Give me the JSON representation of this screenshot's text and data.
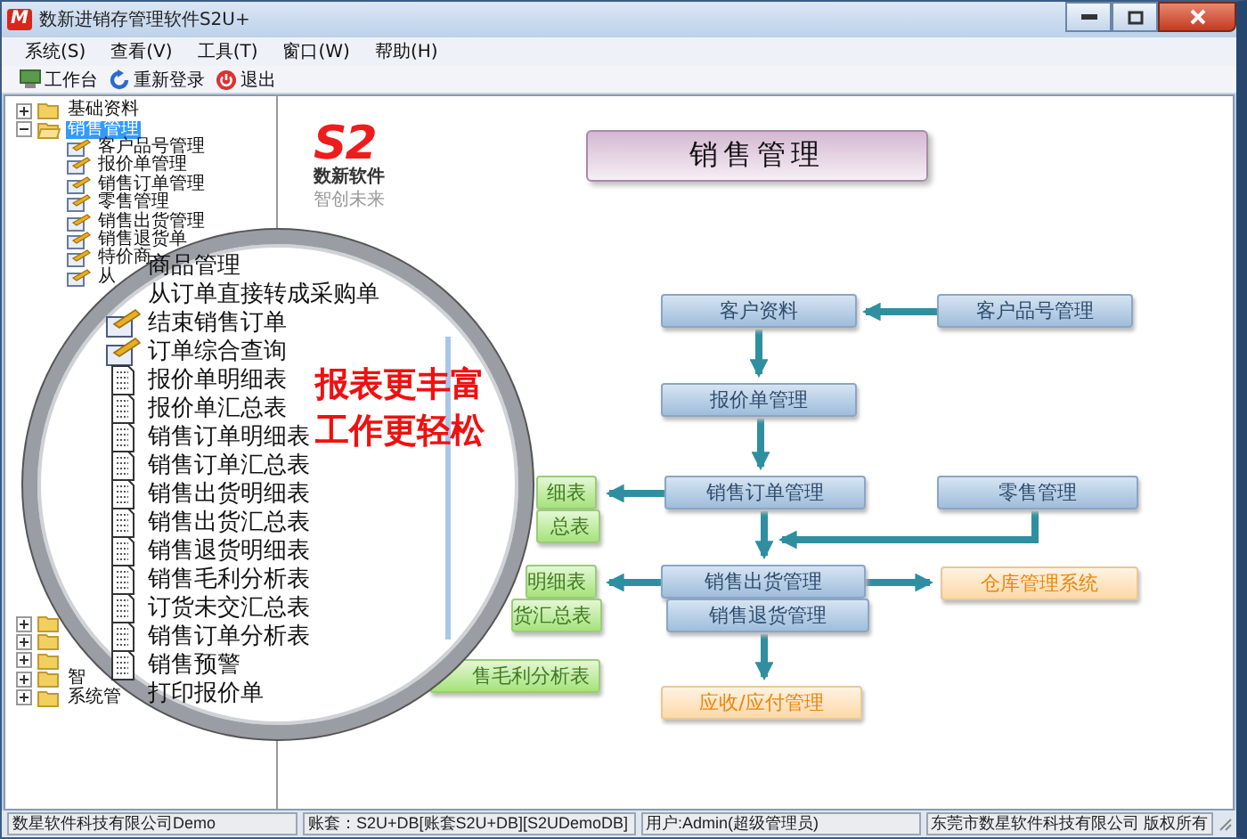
{
  "window": {
    "title": "数新进销存管理软件S2U+",
    "icon_text": "M"
  },
  "menu": [
    {
      "label": "系统(S)"
    },
    {
      "label": "查看(V)"
    },
    {
      "label": "工具(T)"
    },
    {
      "label": "窗口(W)"
    },
    {
      "label": "帮助(H)"
    }
  ],
  "toolbar": [
    {
      "label": "工作台",
      "kind": "desk"
    },
    {
      "label": "重新登录",
      "kind": "relogin"
    },
    {
      "label": "退出",
      "kind": "exit"
    }
  ],
  "tree": [
    {
      "label": "基础资料",
      "expanded": false,
      "selected": false
    },
    {
      "label": "销售管理",
      "expanded": true,
      "selected": true,
      "children": [
        {
          "label": "客户品号管理",
          "selected": false
        },
        {
          "label": "报价单管理",
          "selected": false
        },
        {
          "label": "销售订单管理",
          "selected": false
        },
        {
          "label": "零售管理",
          "selected": false
        },
        {
          "label": "销售出货管理",
          "selected": false
        },
        {
          "label": "销售退货单",
          "selected": false
        },
        {
          "label": "特价商",
          "selected": false
        },
        {
          "label": "从",
          "selected": false
        }
      ]
    }
  ],
  "tree_lower": [
    {
      "expanded": false,
      "selected": false
    },
    {
      "expanded": false,
      "selected": false
    },
    {
      "expanded": false,
      "selected": false
    },
    {
      "label": "智",
      "expanded": false,
      "selected": false
    },
    {
      "label": "系统管",
      "expanded": false,
      "selected": false
    }
  ],
  "logo": {
    "mark": "S2",
    "name": "数新软件",
    "slogan": "智创未来"
  },
  "flowchart": {
    "title": "销售管理",
    "nodes": [
      {
        "label": "客户资料",
        "kind": "module"
      },
      {
        "label": "客户品号管理",
        "kind": "module"
      },
      {
        "label": "报价单管理",
        "kind": "module"
      },
      {
        "label": "销售订单管理",
        "kind": "module"
      },
      {
        "label": "零售管理",
        "kind": "module"
      },
      {
        "label": "销售出货管理",
        "kind": "module"
      },
      {
        "label": "销售退货管理",
        "kind": "module"
      },
      {
        "label": "仓库管理系统",
        "kind": "external"
      },
      {
        "label": "应收/应付管理",
        "kind": "external"
      },
      {
        "label": "细表",
        "kind": "report"
      },
      {
        "label": "总表",
        "kind": "report"
      },
      {
        "label": "明细表",
        "kind": "report"
      },
      {
        "label": "货汇总表",
        "kind": "report"
      },
      {
        "label": "售毛利分析表",
        "kind": "report"
      }
    ]
  },
  "magnifier": {
    "items": [
      {
        "label": "商品管理",
        "kind": "plain"
      },
      {
        "label": "从订单直接转成采购单",
        "kind": "plain"
      },
      {
        "label": "结束销售订单",
        "kind": "form"
      },
      {
        "label": "订单综合查询",
        "kind": "form"
      },
      {
        "label": "报价单明细表",
        "kind": "report"
      },
      {
        "label": "报价单汇总表",
        "kind": "report"
      },
      {
        "label": "销售订单明细表",
        "kind": "report"
      },
      {
        "label": "销售订单汇总表",
        "kind": "report"
      },
      {
        "label": "销售出货明细表",
        "kind": "report"
      },
      {
        "label": "销售出货汇总表",
        "kind": "report"
      },
      {
        "label": "销售退货明细表",
        "kind": "report"
      },
      {
        "label": "销售毛利分析表",
        "kind": "report"
      },
      {
        "label": "订货未交汇总表",
        "kind": "report"
      },
      {
        "label": "销售订单分析表",
        "kind": "report"
      },
      {
        "label": "销售预警",
        "kind": "report"
      },
      {
        "label": "打印报价单",
        "kind": "plain"
      }
    ],
    "slogan": [
      "报表更丰富",
      "工作更轻松"
    ]
  },
  "status_bar": [
    "数星软件科技有限公司Demo",
    "账套：S2U+DB[账套S2U+DB][S2UDemoDB]",
    "用户:Admin(超级管理员)",
    "东莞市数星软件科技有限公司 版权所有"
  ]
}
